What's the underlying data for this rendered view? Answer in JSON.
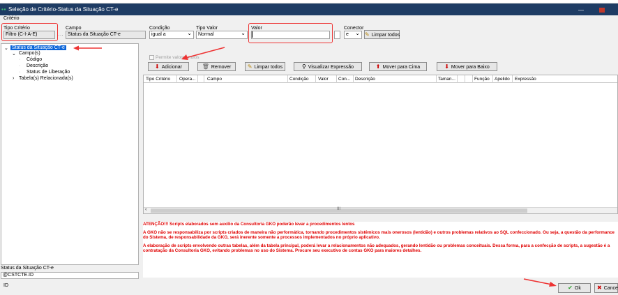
{
  "window": {
    "title": "Seleção de Critério-Status da Situação CT-e"
  },
  "menu": {
    "criterio": "Critério"
  },
  "form": {
    "tipo_criterio": {
      "label": "Tipo Critério",
      "value": "Filtro (C-I-A-E)"
    },
    "campo": {
      "label": "Campo",
      "value": "Status da Situação CT-e"
    },
    "condicao": {
      "label": "Condição",
      "value": "igual a"
    },
    "tipo_valor": {
      "label": "Tipo Valor",
      "value": "Normal"
    },
    "valor": {
      "label": "Valor",
      "value": ""
    },
    "conector": {
      "label": "Conector",
      "value": "e"
    },
    "limpar_todos": "Limpar todos"
  },
  "tree": {
    "root": "Status da Situação CT-e",
    "campos": "Campo(s)",
    "items": [
      "Código",
      "Descrição",
      "Status de Liberação"
    ],
    "tabelas": "Tabela(s) Relacionada(s)",
    "status": "Status da Situação CT-e",
    "path": "@CSTCTE.ID"
  },
  "toolbar": {
    "permite_valores": "Permite valores nulos",
    "adicionar": "Adicionar",
    "remover": "Remover",
    "limpar_todos": "Limpar todos",
    "visualizar": "Visualizar Expressão",
    "mover_cima": "Mover para Cima",
    "mover_baixo": "Mover para Baixo"
  },
  "grid": {
    "columns": [
      "Tipo Critério",
      "Opera...",
      "Campo",
      "Condição",
      "Valor",
      "Con...",
      "Descrição",
      "Taman...",
      "Função",
      "Apelido",
      "Expressão"
    ]
  },
  "warning": {
    "p1": "ATENÇÃO!!! Scripts elaborados sem auxílio da Consultoria GKO poderão levar a procedimentos lentos",
    "p2": "A GKO não se responsabiliza por scripts criados de maneira não performática, tornando procedimentos sistêmicos mais onerosos (lentidão) e outros problemas relativos ao SQL confeccionado. Ou seja, a questão da performance do Sistema, de responsabilidade da GKO, será inerente somente a processos implementados no próprio aplicativo.",
    "p3": "A elaboração de scripts envolvendo outras tabelas, além da tabela principal, poderá levar a relacionamentos não adequados, gerando lentidão ou problemas conceituais. Dessa forma, para a confecção de scripts, a sugestão é a contratação da Consultoria GKO, evitando problemas no uso do Sistema. Procure seu executivo de contas GKO para maiores detalhes."
  },
  "footer": {
    "id_label": "ID",
    "ok": "Ok",
    "cancel": "Cance"
  },
  "colors": {
    "titlebar": "#1e3c64",
    "selection": "#0a64d8",
    "warning": "#e00000",
    "highlight": "#e33333"
  }
}
